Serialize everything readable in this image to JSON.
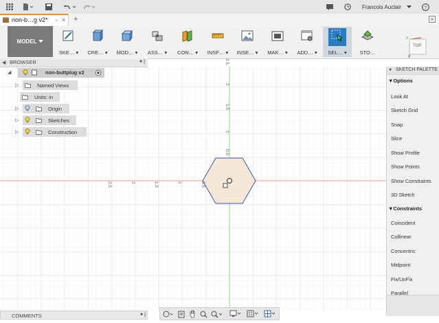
{
  "topbar": {
    "user_name": "Francois Auclair",
    "icons": [
      "apps-grid-icon",
      "file-icon",
      "save-icon",
      "undo-icon",
      "redo-icon",
      "job-status-icon",
      "clock-icon",
      "help-icon"
    ]
  },
  "tab": {
    "title": "non-b…g v2*"
  },
  "toolbar": {
    "workspace": "MODEL",
    "groups": [
      "SKE…",
      "CRE…",
      "MOD…",
      "ASS…",
      "CON…",
      "INSF…",
      "INSE…",
      "MAK…",
      "ADD…",
      "SEL…",
      "STO…"
    ]
  },
  "viewcube": {
    "face": "TOP",
    "axis_x": "X",
    "axis_z": "Z"
  },
  "browser": {
    "title": "BROWSER",
    "root": "non-buttplug v2",
    "items": [
      "Named Views",
      "Units: in",
      "Origin",
      "Sketches",
      "Construction"
    ]
  },
  "canvas": {
    "v_ticks": [
      "2.5",
      "2",
      "1.5",
      "1",
      "0.5"
    ],
    "h_ticks": [
      "2.5",
      "2",
      "1.5",
      "1",
      "0.5"
    ]
  },
  "palette": {
    "title": "SKETCH PALETTE",
    "options_header": "Options",
    "options": [
      "Look At",
      "Sketch Grid",
      "Snap",
      "Slice",
      "Show Profile",
      "Show Points",
      "Show Constraints",
      "3D Sketch"
    ],
    "constraints_header": "Constraints",
    "constraints": [
      "Coincident",
      "Collinear",
      "Concentric",
      "Midpoint",
      "Fix/UnFix",
      "Parallel"
    ]
  },
  "comments": {
    "title": "COMMENTS"
  }
}
